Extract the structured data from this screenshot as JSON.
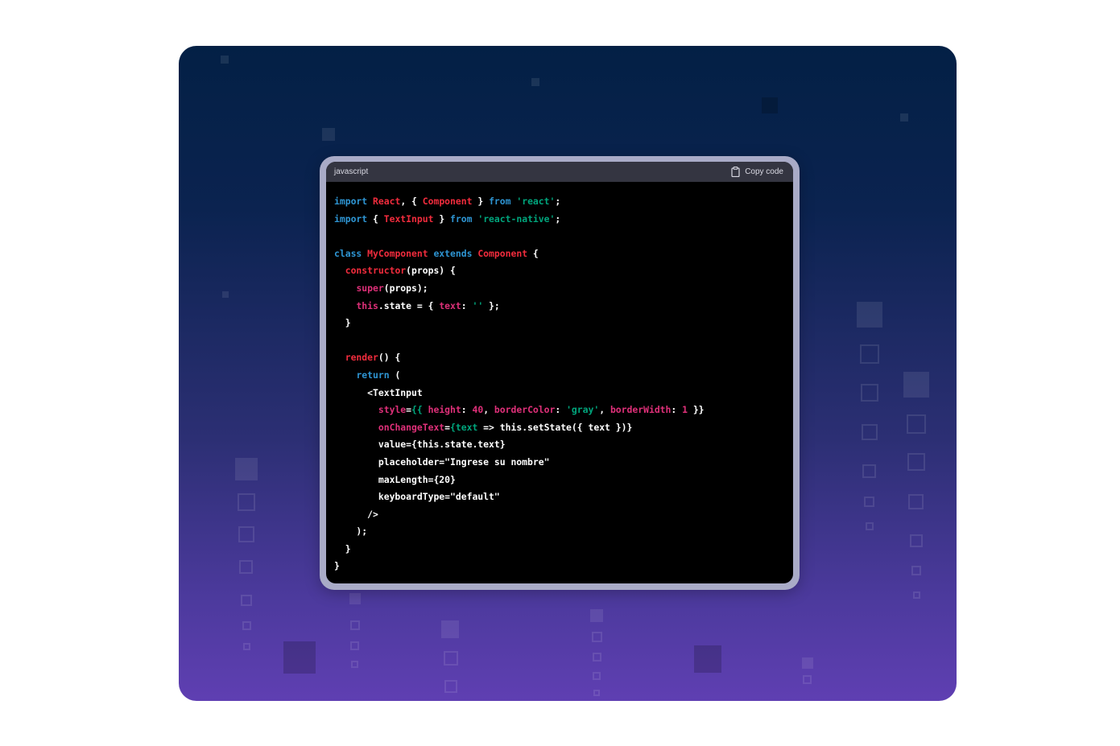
{
  "code_block": {
    "language": "javascript",
    "copy_label": "Copy code",
    "lines": [
      [
        {
          "t": "import",
          "c": "kw"
        },
        {
          "t": " ",
          "c": "plain"
        },
        {
          "t": "React",
          "c": "fn"
        },
        {
          "t": ", { ",
          "c": "plain"
        },
        {
          "t": "Component",
          "c": "fn"
        },
        {
          "t": " } ",
          "c": "plain"
        },
        {
          "t": "from",
          "c": "kw"
        },
        {
          "t": " ",
          "c": "plain"
        },
        {
          "t": "'react'",
          "c": "str"
        },
        {
          "t": ";",
          "c": "plain"
        }
      ],
      [
        {
          "t": "import",
          "c": "kw"
        },
        {
          "t": " { ",
          "c": "plain"
        },
        {
          "t": "TextInput",
          "c": "fn"
        },
        {
          "t": " } ",
          "c": "plain"
        },
        {
          "t": "from",
          "c": "kw"
        },
        {
          "t": " ",
          "c": "plain"
        },
        {
          "t": "'react-native'",
          "c": "str"
        },
        {
          "t": ";",
          "c": "plain"
        }
      ],
      [],
      [
        {
          "t": "class",
          "c": "kw"
        },
        {
          "t": " ",
          "c": "plain"
        },
        {
          "t": "MyComponent",
          "c": "fn"
        },
        {
          "t": " ",
          "c": "plain"
        },
        {
          "t": "extends",
          "c": "kw"
        },
        {
          "t": " ",
          "c": "plain"
        },
        {
          "t": "Component",
          "c": "fn"
        },
        {
          "t": " {",
          "c": "plain"
        }
      ],
      [
        {
          "t": "  ",
          "c": "plain"
        },
        {
          "t": "constructor",
          "c": "fn"
        },
        {
          "t": "(props) {",
          "c": "plain"
        }
      ],
      [
        {
          "t": "    ",
          "c": "plain"
        },
        {
          "t": "super",
          "c": "prop"
        },
        {
          "t": "(props);",
          "c": "plain"
        }
      ],
      [
        {
          "t": "    ",
          "c": "plain"
        },
        {
          "t": "this",
          "c": "prop"
        },
        {
          "t": ".state = { ",
          "c": "plain"
        },
        {
          "t": "text",
          "c": "prop"
        },
        {
          "t": ": ",
          "c": "plain"
        },
        {
          "t": "''",
          "c": "str"
        },
        {
          "t": " };",
          "c": "plain"
        }
      ],
      [
        {
          "t": "  }",
          "c": "plain"
        }
      ],
      [],
      [
        {
          "t": "  ",
          "c": "plain"
        },
        {
          "t": "render",
          "c": "fn"
        },
        {
          "t": "() {",
          "c": "plain"
        }
      ],
      [
        {
          "t": "    ",
          "c": "plain"
        },
        {
          "t": "return",
          "c": "kw"
        },
        {
          "t": " (",
          "c": "plain"
        }
      ],
      [
        {
          "t": "      <TextInput",
          "c": "plain"
        }
      ],
      [
        {
          "t": "        ",
          "c": "plain"
        },
        {
          "t": "style",
          "c": "prop"
        },
        {
          "t": "=",
          "c": "plain"
        },
        {
          "t": "{{ ",
          "c": "str"
        },
        {
          "t": "height",
          "c": "prop"
        },
        {
          "t": ": ",
          "c": "plain"
        },
        {
          "t": "40",
          "c": "num"
        },
        {
          "t": ", ",
          "c": "plain"
        },
        {
          "t": "borderColor",
          "c": "prop"
        },
        {
          "t": ": ",
          "c": "plain"
        },
        {
          "t": "'gray'",
          "c": "str"
        },
        {
          "t": ", ",
          "c": "plain"
        },
        {
          "t": "borderWidth",
          "c": "prop"
        },
        {
          "t": ": ",
          "c": "plain"
        },
        {
          "t": "1",
          "c": "num"
        },
        {
          "t": " }}",
          "c": "plain"
        }
      ],
      [
        {
          "t": "        ",
          "c": "plain"
        },
        {
          "t": "onChangeText",
          "c": "prop"
        },
        {
          "t": "=",
          "c": "plain"
        },
        {
          "t": "{text",
          "c": "str"
        },
        {
          "t": " => this.setState({ text })}",
          "c": "plain"
        }
      ],
      [
        {
          "t": "        value={this.state.text}",
          "c": "plain"
        }
      ],
      [
        {
          "t": "        placeholder=\"Ingrese su nombre\"",
          "c": "plain"
        }
      ],
      [
        {
          "t": "        maxLength={20}",
          "c": "plain"
        }
      ],
      [
        {
          "t": "        keyboardType=\"default\"",
          "c": "plain"
        }
      ],
      [
        {
          "t": "      />",
          "c": "plain"
        }
      ],
      [
        {
          "t": "    );",
          "c": "plain"
        }
      ],
      [
        {
          "t": "  }",
          "c": "plain"
        }
      ],
      [
        {
          "t": "}",
          "c": "plain"
        }
      ]
    ]
  },
  "colors": {
    "keyword": "#2e95d3",
    "identifier": "#f22c3d",
    "property": "#df3079",
    "string": "#00a67d",
    "header_bg": "#343541",
    "code_bg": "#000000"
  },
  "icons": {
    "copy": "clipboard-icon"
  }
}
